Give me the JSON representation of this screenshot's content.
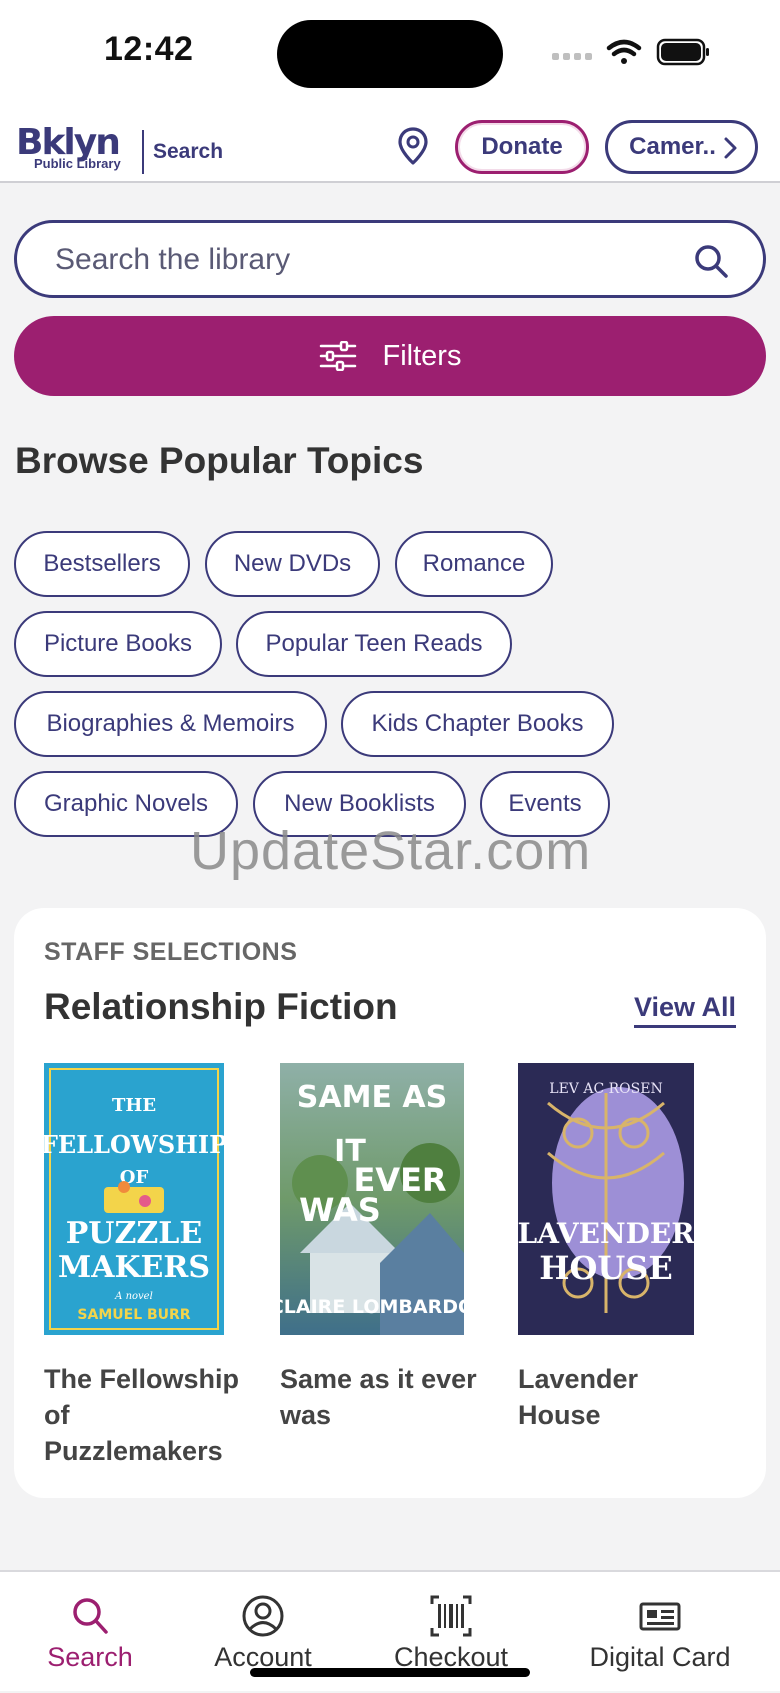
{
  "status_bar": {
    "time": "12:42"
  },
  "header": {
    "logo_main": "Bklyn",
    "logo_sub": "Public Library",
    "section_label": "Search",
    "donate_label": "Donate",
    "camera_label": "Camer.."
  },
  "search": {
    "placeholder": "Search the library"
  },
  "filters": {
    "label": "Filters"
  },
  "topics": {
    "heading": "Browse Popular Topics",
    "chips": [
      "Bestsellers",
      "New DVDs",
      "Romance",
      "Picture Books",
      "Popular Teen Reads",
      "Biographies & Memoirs",
      "Kids Chapter Books",
      "Graphic Novels",
      "New Booklists",
      "Events"
    ]
  },
  "watermark": "UpdateStar.com",
  "staff": {
    "eyebrow": "STAFF SELECTIONS",
    "title": "Relationship Fiction",
    "view_all": "View All",
    "books": [
      {
        "title": "The Fellowship of Puzzlemakers",
        "cover_lines": [
          "THE",
          "FELLOWSHIP",
          "OF",
          "PUZZLE",
          "MAKERS"
        ],
        "cover_tag": "A novel",
        "cover_author": "SAMUEL BURR"
      },
      {
        "title": "Same as it ever was",
        "cover_lines": [
          "SAME AS",
          "IT",
          "EVER",
          "WAS"
        ],
        "cover_author": "CLAIRE LOMBARDO"
      },
      {
        "title": "Lavender House",
        "cover_lines": [
          "LAVENDER",
          "HOUSE"
        ],
        "cover_author": "LEV AC ROSEN"
      }
    ]
  },
  "tabs": [
    {
      "label": "Search",
      "icon": "search-icon",
      "active": true
    },
    {
      "label": "Account",
      "icon": "account-icon",
      "active": false
    },
    {
      "label": "Checkout",
      "icon": "barcode-icon",
      "active": false
    },
    {
      "label": "Digital Card",
      "icon": "card-icon",
      "active": false
    }
  ],
  "colors": {
    "brand_navy": "#3b3a7a",
    "brand_magenta": "#9c1f70"
  }
}
